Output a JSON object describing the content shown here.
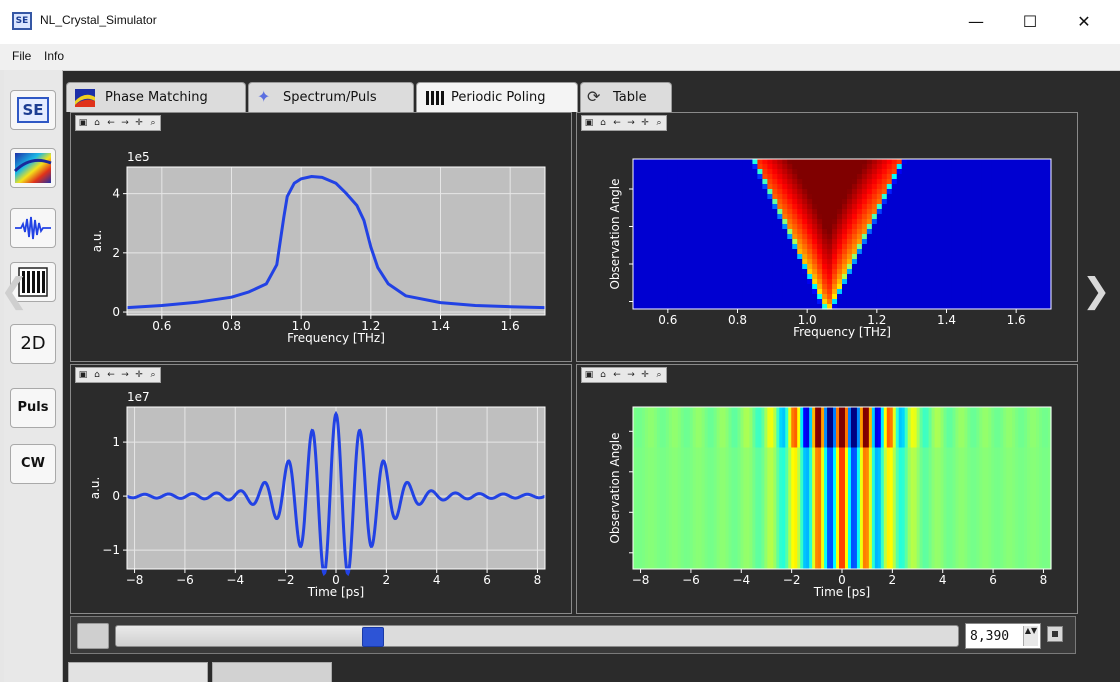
{
  "window": {
    "title": "NL_Crystal_Simulator",
    "icon_label": "SE",
    "minimize": "—",
    "maximize": "☐",
    "close": "✕"
  },
  "menu": {
    "file": "File",
    "info": "Info"
  },
  "sidebar": {
    "se_label": "SE",
    "two_d_label": "2D",
    "puls_label": "Puls",
    "cw_label": "CW"
  },
  "tabs": [
    {
      "label": "Phase Matching",
      "icon": "phase-matching-icon"
    },
    {
      "label": "Spectrum/Puls",
      "icon": "spectrum-star-icon"
    },
    {
      "label": "Periodic Poling",
      "icon": "poling-bars-icon"
    },
    {
      "label": "Table",
      "icon": "table-refresh-icon"
    }
  ],
  "toolbar_icons": [
    "save-icon",
    "home-icon",
    "back-icon",
    "forward-icon",
    "pan-icon",
    "zoom-icon"
  ],
  "bottom_bar": {
    "spin_value": "8,390",
    "slider_position": 0.3,
    "spin_arrows": "▲▼"
  },
  "colors": {
    "plot_bg": "#bfbfbf",
    "line": "#2242e4",
    "panel_bg": "#2b2b2b",
    "slider_handle": "#2d54d6"
  },
  "chart_data": [
    {
      "type": "line",
      "title": "",
      "xlabel": "Frequency [THz]",
      "ylabel": "a.u.",
      "offset_text": "1e5",
      "xlim": [
        0.5,
        1.7
      ],
      "ylim": [
        -0.1,
        4.9
      ],
      "xticks": [
        "0.6",
        "0.8",
        "1.0",
        "1.2",
        "1.4",
        "1.6"
      ],
      "yticks": [
        "0",
        "2",
        "4"
      ],
      "grid": true,
      "x": [
        0.5,
        0.6,
        0.7,
        0.8,
        0.85,
        0.9,
        0.93,
        0.95,
        0.96,
        0.98,
        1.0,
        1.03,
        1.06,
        1.1,
        1.13,
        1.16,
        1.18,
        1.2,
        1.22,
        1.25,
        1.3,
        1.4,
        1.5,
        1.6,
        1.7
      ],
      "y": [
        0.15,
        0.22,
        0.33,
        0.5,
        0.68,
        0.95,
        1.6,
        3.2,
        3.9,
        4.35,
        4.5,
        4.58,
        4.55,
        4.35,
        4.0,
        3.6,
        3.1,
        2.2,
        1.5,
        0.95,
        0.55,
        0.32,
        0.22,
        0.18,
        0.15
      ]
    },
    {
      "type": "heatmap",
      "title": "",
      "xlabel": "Frequency [THz]",
      "ylabel": "Observation Angle",
      "xlim": [
        0.5,
        1.7
      ],
      "xticks": [
        "0.6",
        "0.8",
        "1.0",
        "1.2",
        "1.4",
        "1.6"
      ],
      "colormap": "jet",
      "description_shape": "V",
      "v_apex_x": 1.06,
      "v_top_left_x": 0.86,
      "v_top_right_x": 1.26
    },
    {
      "type": "line",
      "title": "",
      "xlabel": "Time [ps]",
      "ylabel": "a.u.",
      "offset_text": "1e7",
      "xlim": [
        -8.3,
        8.3
      ],
      "ylim": [
        -1.35,
        1.65
      ],
      "xticks": [
        "−8",
        "−6",
        "−4",
        "−2",
        "0",
        "2",
        "4",
        "6",
        "8"
      ],
      "yticks": [
        "−1",
        "0",
        "1"
      ],
      "grid": true,
      "waveform": {
        "amplitude": 1.4,
        "period_ps": 0.95,
        "envelope_sigma_ps": 1.4,
        "tail_amplitude": 0.12
      }
    },
    {
      "type": "heatmap",
      "title": "",
      "xlabel": "Time [ps]",
      "ylabel": "Observation Angle",
      "xlim": [
        -8.3,
        8.3
      ],
      "xticks": [
        "−8",
        "−6",
        "−4",
        "−2",
        "0",
        "2",
        "4",
        "6",
        "8"
      ],
      "colormap": "jet",
      "description_shape": "vertical-stripes"
    }
  ]
}
